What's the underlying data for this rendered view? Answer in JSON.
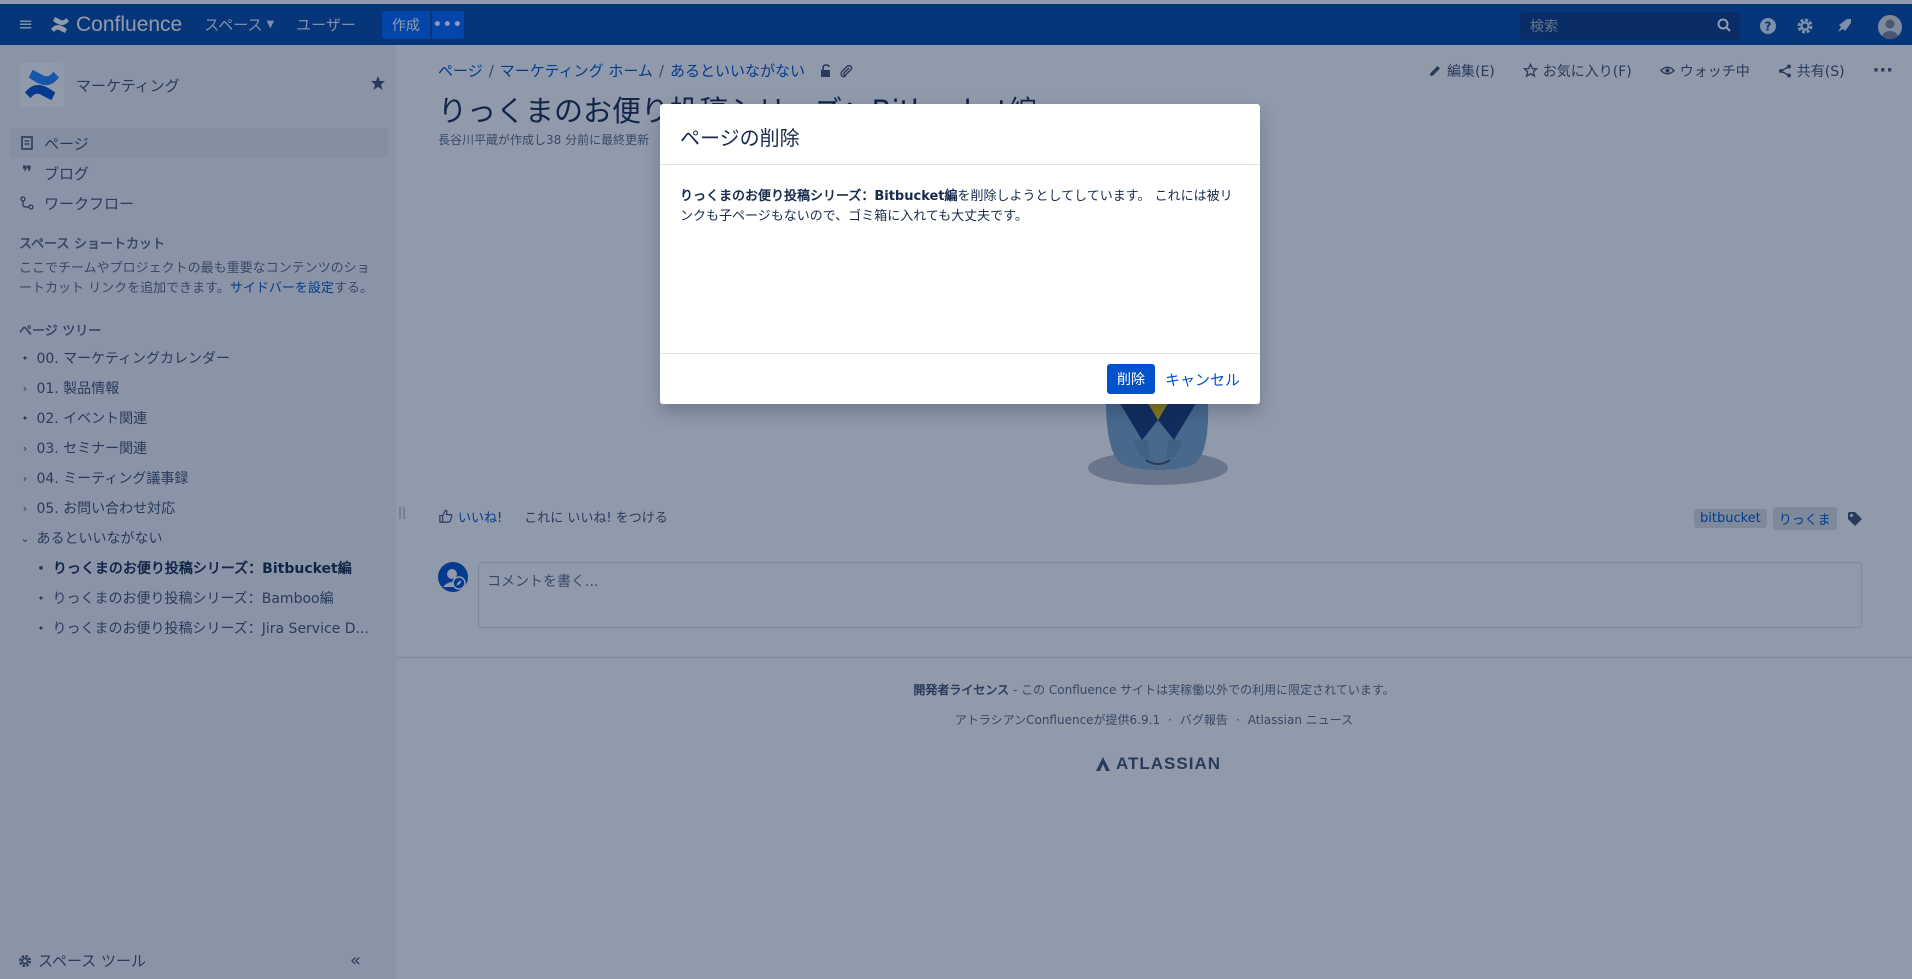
{
  "topnav": {
    "app_name": "Confluence",
    "spaces": "スペース",
    "users": "ユーザー",
    "create": "作成",
    "more": "•••",
    "search_placeholder": "検索"
  },
  "sidebar": {
    "space_name": "マーケティング",
    "nav": [
      {
        "label": "ページ"
      },
      {
        "label": "ブログ"
      },
      {
        "label": "ワークフロー"
      }
    ],
    "shortcuts_title": "スペース ショートカット",
    "shortcuts_text": "ここでチームやプロジェクトの最も重要なコンテンツのショートカット リンクを追加できます。",
    "shortcuts_link": "サイドバーを設定",
    "shortcuts_suffix": "する。",
    "tree_title": "ページ ツリー",
    "tree": [
      {
        "label": "00. マーケティングカレンダー",
        "marker": "•"
      },
      {
        "label": "01. 製品情報",
        "marker": "›"
      },
      {
        "label": "02. イベント関連",
        "marker": "•"
      },
      {
        "label": "03. セミナー関連",
        "marker": "›"
      },
      {
        "label": "04. ミーティング議事録",
        "marker": "›"
      },
      {
        "label": "05. お問い合わせ対応",
        "marker": "›"
      },
      {
        "label": "あるといいながない",
        "marker": "⌄"
      }
    ],
    "tree_children": [
      {
        "label": "りっくまのお便り投稿シリーズ：Bitbucket編"
      },
      {
        "label": "りっくまのお便り投稿シリーズ：Bamboo編"
      },
      {
        "label": "りっくまのお便り投稿シリーズ：Jira Service D..."
      }
    ],
    "space_tools": "スペース ツール",
    "collapse": "«"
  },
  "breadcrumb": [
    "ページ",
    "マーケティング ホーム",
    "あるといいながない"
  ],
  "actions": {
    "edit": "編集(E)",
    "favorite": "お気に入り(F)",
    "watch": "ウォッチ中",
    "share": "共有(S)",
    "more": "···"
  },
  "page": {
    "title": "りっくまのお便り投稿シリーズ：Bitbucket編",
    "byline": "長谷川平蔵が作成し38 分前に最終更新",
    "like": "いいね!",
    "like_hint": "これに いいね! をつける",
    "labels": [
      "bitbucket",
      "りっくま"
    ],
    "comment_placeholder": "コメントを書く..."
  },
  "footer": {
    "license_bold": "開発者ライセンス",
    "license_rest": " - この Confluence サイトは実稼働以外での利用に限定されています。",
    "powered": "アトラシアンConfluenceが提供6.9.1",
    "bug": "バグ報告",
    "news": "Atlassian ニュース",
    "logo": "ATLASSIAN"
  },
  "dialog": {
    "title": "ページの削除",
    "body_bold": "りっくまのお便り投稿シリーズ：Bitbucket編",
    "body_rest": "を削除しようとしてしています。 これには被リンクも子ページもないので、ゴミ箱に入れても大丈夫です。",
    "delete": "削除",
    "cancel": "キャンセル"
  },
  "colors": {
    "nav_bg": "#0747a6",
    "primary": "#0052cc",
    "overlay": "rgba(9,30,66,0.45)"
  }
}
